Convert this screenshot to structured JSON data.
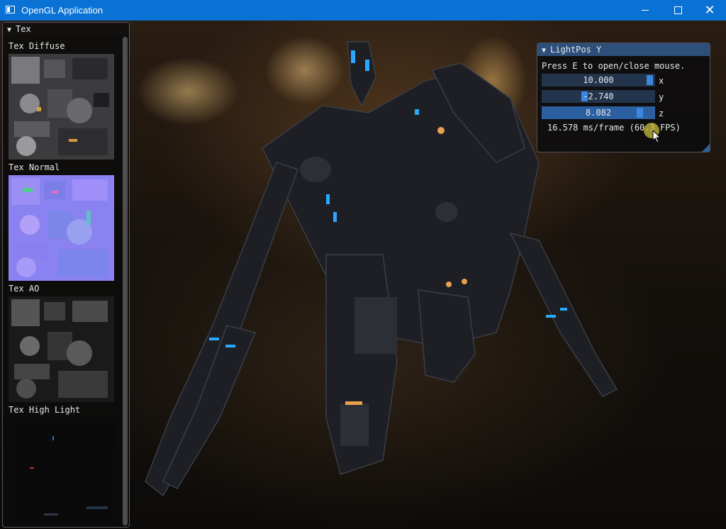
{
  "window": {
    "title": "OpenGL Application",
    "controls": {
      "minimize": "minimize-icon",
      "maximize": "maximize-icon",
      "close": "close-icon"
    },
    "accent_color": "#0a72d4"
  },
  "tex_panel": {
    "title": "Tex",
    "textures": [
      {
        "label": "Tex Diffuse",
        "kind": "diffuse"
      },
      {
        "label": "Tex Normal",
        "kind": "normal"
      },
      {
        "label": "Tex AO",
        "kind": "ao"
      },
      {
        "label": "Tex High Light",
        "kind": "highlight"
      }
    ]
  },
  "light_window": {
    "title": "LightPos Y",
    "hint": "Press E to open/close mouse.",
    "sliders": [
      {
        "axis": "x",
        "value": "10.000",
        "fraction": 0.99
      },
      {
        "axis": "y",
        "value": "-2.740",
        "fraction": 0.36
      },
      {
        "axis": "z",
        "value": "8.082",
        "fraction": 0.9
      }
    ],
    "fps": "16.578 ms/frame (60.3 FPS)",
    "slider_color": "#3d86e0",
    "header_color": "#2d4f7a"
  }
}
